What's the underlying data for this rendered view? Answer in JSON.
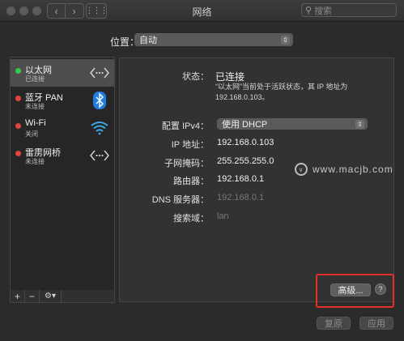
{
  "window": {
    "title": "网络",
    "search_placeholder": "搜索"
  },
  "location": {
    "label": "位置：",
    "value": "自动"
  },
  "sidebar": {
    "items": [
      {
        "name": "以太网",
        "status": "已连接",
        "dot_color": "#34c84a",
        "icon": "ethernet-icon",
        "selected": true
      },
      {
        "name": "蓝牙 PAN",
        "status": "未连接",
        "dot_color": "#e0443e",
        "icon": "bluetooth-icon",
        "selected": false
      },
      {
        "name": "Wi-Fi",
        "status": "关闭",
        "dot_color": "#e0443e",
        "icon": "wifi-icon",
        "selected": false
      },
      {
        "name": "雷雳网桥",
        "status": "未连接",
        "dot_color": "#e0443e",
        "icon": "ethernet-icon",
        "selected": false
      }
    ],
    "add_label": "+",
    "remove_label": "−",
    "gear_label": "⚙▾"
  },
  "detail": {
    "status_label": "状态：",
    "status_value": "已连接",
    "status_desc": "“以太网”当前处于活跃状态，其 IP 地址为 192.168.0.103。",
    "ipv4_label": "配置 IPv4：",
    "ipv4_value": "使用 DHCP",
    "ip_label": "IP 地址：",
    "ip_value": "192.168.0.103",
    "mask_label": "子网掩码：",
    "mask_value": "255.255.255.0",
    "router_label": "路由器：",
    "router_value": "192.168.0.1",
    "dns_label": "DNS 服务器：",
    "dns_value": "192.168.0.1",
    "search_domain_label": "搜索域：",
    "search_domain_value": "lan"
  },
  "buttons": {
    "advanced": "高级...",
    "help": "?",
    "revert": "复原",
    "apply": "应用"
  },
  "watermark": "www.macjb.com",
  "colors": {
    "highlight": "#e5302a",
    "connected": "#34c84a",
    "disconnected": "#e0443e",
    "bluetooth": "#1f7ee0"
  }
}
